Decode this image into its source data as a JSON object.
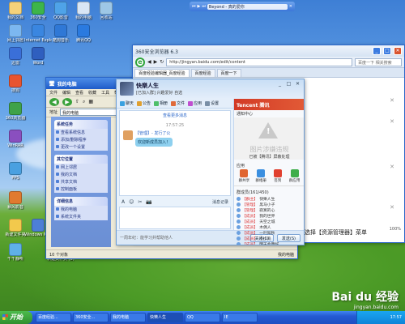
{
  "desktop_icons": [
    {
      "label": "我的文档",
      "color": "#f5d27a"
    },
    {
      "label": "360安全",
      "color": "#3db54a"
    },
    {
      "label": "QQ影音",
      "color": "#4fa3e8"
    },
    {
      "label": "我的电脑",
      "color": "#d9e6f5"
    },
    {
      "label": "回收站",
      "color": "#9ec7e6"
    },
    {
      "label": "网上邻居",
      "color": "#7cb7f0"
    },
    {
      "label": "Internet Explorer",
      "color": "#3a86e0"
    },
    {
      "label": "酷狗音乐",
      "color": "#2f78d6"
    },
    {
      "label": "腾讯QQ",
      "color": "#2a7ae0"
    },
    {
      "label": "迅雷",
      "color": "#3a6fd8"
    },
    {
      "label": "Word",
      "color": "#2f5fbf"
    },
    {
      "label": "搜狗",
      "color": "#e8542f"
    },
    {
      "label": "360浏览器",
      "color": "#3fa24a"
    },
    {
      "label": "WinRAR",
      "color": "#8a4fbf"
    },
    {
      "label": "PPS",
      "color": "#4aa0e0"
    },
    {
      "label": "暴风影音",
      "color": "#e07a2f"
    },
    {
      "label": "新建文件夹",
      "color": "#f2c94c"
    },
    {
      "label": "千千静听",
      "color": "#5fb0e8"
    },
    {
      "label": "Windows Media",
      "color": "#4d7fd6"
    },
    {
      "label": "新建文件夹 (2)",
      "color": "#f2c94c"
    }
  ],
  "player": {
    "title": "Beyond - 真的爱你",
    "icons": [
      "prev-icon",
      "play-icon",
      "next-icon"
    ]
  },
  "mycomputer": {
    "title": "我的电脑",
    "menu": [
      "文件",
      "编辑",
      "查看",
      "收藏",
      "工具",
      "帮助"
    ],
    "address_label": "地址",
    "address": "我的电脑",
    "sections": [
      {
        "title": "系统任务",
        "items": [
          "查看系统信息",
          "添加/删除程序",
          "更改一个设置"
        ]
      },
      {
        "title": "其它位置",
        "items": [
          "网上邻居",
          "我的文档",
          "共享文档",
          "控制面板"
        ]
      },
      {
        "title": "详细信息",
        "items": [
          "我的电脑",
          "系统文件夹"
        ]
      }
    ],
    "status_left": "10 个对象",
    "status_right": "我的电脑"
  },
  "browser": {
    "title": "360安全浏览器 6.3",
    "url": "http://jingyan.baidu.com/edit/content",
    "search_placeholder": "百度一下 相关搜索",
    "tabs": [
      "百度经验编辑器_百度经验",
      "百度经验",
      "百度一下"
    ],
    "page_text": "选择【资源管理器】菜单",
    "zoom": "100%"
  },
  "qq": {
    "name": "快樂人生",
    "signature": "[已加入群] 兴趣爱好 自选",
    "toolbar": [
      "聊天",
      "公告",
      "相册",
      "文件",
      "应用",
      "设置"
    ],
    "view_more": "查看更多消息",
    "timestamp": "17:57:25",
    "message_meta": "【管理】- 发行了公",
    "message_text": "欢迎新成员加入！",
    "input_tools": [
      "A",
      "☺",
      "✂",
      "📷"
    ],
    "send_hint": "消息记录",
    "tip": "一周年纪：能学习并帮助他人",
    "close_label": "关闭(C)",
    "send_label": "发送(S)",
    "right": {
      "brand": "Tencent 腾讯",
      "app_center": "通知中心",
      "violation_title": "图片涉嫌违规",
      "violation_sub": "已被【腾讯】屏蔽处理",
      "apps_title": "应用",
      "apps": [
        {
          "label": "群共享",
          "color": "#e0642f"
        },
        {
          "label": "群相册",
          "color": "#3a8fe0"
        },
        {
          "label": "签到",
          "color": "#e0402f"
        },
        {
          "label": "群应用",
          "color": "#3fae4a"
        }
      ],
      "members_title": "群成员(161/450)",
      "members": [
        {
          "role": "【群主】",
          "name": "快樂人生"
        },
        {
          "role": "【管理】",
          "name": "黑马小子"
        },
        {
          "role": "【管理】",
          "name": "寂寞的心"
        },
        {
          "role": "【成员】",
          "name": "我的世界"
        },
        {
          "role": "【成员】",
          "name": "天空之城"
        },
        {
          "role": "【成员】",
          "name": "木偶人"
        },
        {
          "role": "【成员】",
          "name": "一叶知秋"
        },
        {
          "role": "【成员】",
          "name": "小小鸟"
        },
        {
          "role": "【成员】",
          "name": "明天会更好"
        }
      ]
    }
  },
  "taskbar": {
    "start_label": "开始",
    "tasks": [
      "百度经验...",
      "360安全...",
      "我的电脑",
      "快樂人生",
      "QQ",
      "IE"
    ],
    "clock": "17:57"
  },
  "watermark": {
    "brand": "Bai du 经验",
    "url": "jingyan.baidu.com"
  }
}
